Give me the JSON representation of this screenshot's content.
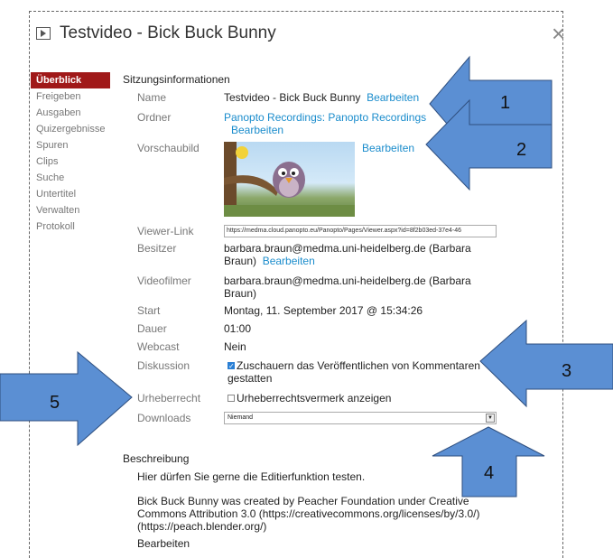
{
  "window": {
    "title": "Testvideo - Bick Buck Bunny",
    "close": "×"
  },
  "sidebar": {
    "items": [
      {
        "label": "Überblick"
      },
      {
        "label": "Freigeben"
      },
      {
        "label": "Ausgaben"
      },
      {
        "label": "Quizergebnisse"
      },
      {
        "label": "Spuren"
      },
      {
        "label": "Clips"
      },
      {
        "label": "Suche"
      },
      {
        "label": "Untertitel"
      },
      {
        "label": "Verwalten"
      },
      {
        "label": "Protokoll"
      }
    ]
  },
  "session": {
    "heading": "Sitzungsinformationen",
    "name_label": "Name",
    "name_value": "Testvideo - Bick Buck Bunny",
    "name_edit": "Bearbeiten",
    "folder_label": "Ordner",
    "folder_value": "Panopto Recordings: Panopto Recordings",
    "folder_edit": "Bearbeiten",
    "thumb_label": "Vorschaubild",
    "thumb_edit": "Bearbeiten",
    "viewer_label": "Viewer-Link",
    "viewer_value": "https://medma.cloud.panopto.eu/Panopto/Pages/Viewer.aspx?id=8f2b03ed-37e4-46",
    "owner_label": "Besitzer",
    "owner_value_1": "barbara.braun@medma.uni-heidelberg.de (Barbara",
    "owner_value_2": "Braun)",
    "owner_edit": "Bearbeiten",
    "videographer_label": "Videofilmer",
    "videographer_value_1": "barbara.braun@medma.uni-heidelberg.de (Barbara",
    "videographer_value_2": "Braun)",
    "start_label": "Start",
    "start_value": "Montag, 11. September 2017 @ 15:34:26",
    "duration_label": "Dauer",
    "duration_value": "01:00",
    "webcast_label": "Webcast",
    "webcast_value": "Nein",
    "discussion_label": "Diskussion",
    "discussion_text_1": "Zuschauern das Veröffentlichen von Kommentaren",
    "discussion_text_2": "gestatten",
    "discussion_checked": true,
    "copyright_label": "Urheberrecht",
    "copyright_text": "Urheberrechtsvermerk anzeigen",
    "copyright_checked": false,
    "downloads_label": "Downloads",
    "downloads_value": "Niemand"
  },
  "description": {
    "heading": "Beschreibung",
    "line1": "Hier dürfen Sie gerne die Editierfunktion testen.",
    "line2a": "Bick Buck Bunny was created by Peacher Foundation under Creative",
    "line2b": "Commons Attribution 3.0 (https://creativecommons.org/licenses/by/3.0/)",
    "line2c": "(https://peach.blender.org/)",
    "edit": "Bearbeiten"
  },
  "annotations": {
    "n1": "1",
    "n2": "2",
    "n3": "3",
    "n4": "4",
    "n5": "5",
    "arrow_color": "#5b8fd3"
  }
}
